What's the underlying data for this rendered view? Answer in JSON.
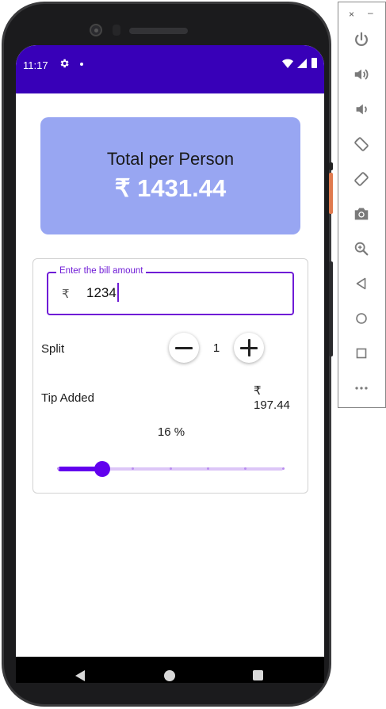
{
  "status_bar": {
    "time": "11:17"
  },
  "total_card": {
    "label": "Total per Person",
    "amount": "₹ 1431.44"
  },
  "bill_field": {
    "legend": "Enter the bill amount",
    "currency": "₹",
    "value": "1234"
  },
  "split": {
    "label": "Split",
    "count": "1"
  },
  "tip": {
    "label": "Tip Added",
    "currency": "₹",
    "amount": "197.44",
    "percent_label": "16 %"
  },
  "slider": {
    "fraction": 0.16,
    "steps": 6
  },
  "colors": {
    "status_bar": "#3800b8",
    "card": "#98a6f2",
    "accent": "#6200ee",
    "field_border": "#6f1bd6"
  },
  "toolbar": {
    "close": "×",
    "minimize": "–",
    "icons": [
      "power-icon",
      "volume-up-icon",
      "volume-down-icon",
      "rotate-left-icon",
      "rotate-right-icon",
      "camera-icon",
      "zoom-icon",
      "back-icon",
      "home-icon",
      "overview-icon",
      "more-icon"
    ]
  }
}
